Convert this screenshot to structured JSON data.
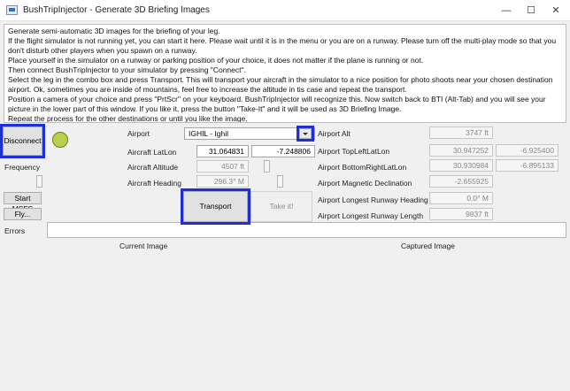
{
  "window": {
    "title": "BushTripInjector - Generate 3D Briefing Images",
    "minimize": "—",
    "maximize": "☐",
    "close": "✕"
  },
  "info_lines": [
    "Generate semi-automatic 3D images for the briefing of your leg.",
    "If the flight simulator is not running yet, you can start it here. Please wait until it is in the menu or you are on a runway. Please turn off the multi-play mode so that you",
    "don't disturb other players when you spawn on a runway.",
    "Place yourself in the simulator on a runway or parking position of your choice, it does not matter if the plane is running or not.",
    "Then connect BushTripInjector to your simulator by pressing \"Connect\".",
    "Select the leg in the combo box and press Transport. This will transport your aircraft in the simulator to a nice position for photo shoots near your chosen destination",
    "airport. Ok, sometimes you are inside of mountains, feel free to increase the altitude in tis case and repeat the transport.",
    " Position a camera of your choice and press \"PrtScr\" on your keyboard. BushTripInjector will recognize this. Now switch back to BTI (Alt-Tab) and you will see your",
    "picture in the lower part of this window. If you like it, press the button \"Take-It\" and it will be used as 3D Briefing Image.",
    "Repeat the process for the other destinations or until you like the image."
  ],
  "left_panel": {
    "disconnect_label": "Disconnect",
    "frequency_label": "Frequency",
    "frequency_level": 0.5,
    "start_msfs_label": "Start MSFS",
    "fly_label": "Fly...",
    "errors_label": "Errors"
  },
  "aircraft": {
    "airport_label": "Airport",
    "airport_value": "IGHIL - Ighil",
    "latlon_label": "Aircraft LatLon",
    "lat": "31.064831",
    "lon": "-7.248806",
    "altitude_label": "Aircraft Altitude",
    "altitude_value": "4507 ft",
    "heading_label": "Aircraft Heading",
    "heading_value": "296.3° M",
    "transport_label": "Transport",
    "takeit_label": "Take it!"
  },
  "airport_info": {
    "alt_label": "Airport Alt",
    "alt_value": "3747 ft",
    "topleft_label": "Airport TopLeftLatLon",
    "topleft_lat": "30.947252",
    "topleft_lon": "-6.925400",
    "bottomright_label": "Airport BottomRightLatLon",
    "bottomright_lat": "30.930984",
    "bottomright_lon": "-6.895133",
    "magdecl_label": "Airport Magnetic Declination",
    "magdecl_value": "-2.655925",
    "rwy_heading_label": "Airport Longest Runway Heading",
    "rwy_heading_value": "0.0° M",
    "rwy_length_label": "Airport Longest Runway Length",
    "rwy_length_value": "9837 ft"
  },
  "images": {
    "current_label": "Current Image",
    "captured_label": "Captured Image"
  },
  "colors": {
    "highlight": "#1f2fd3",
    "status_dot": "#b9d04a"
  }
}
